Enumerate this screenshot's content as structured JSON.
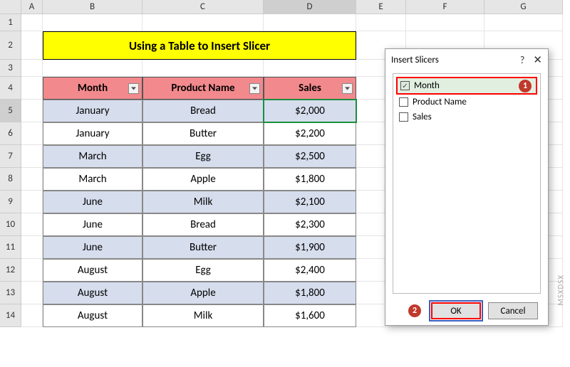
{
  "columns": [
    "A",
    "B",
    "C",
    "D",
    "E",
    "F",
    "G"
  ],
  "rows_small": [
    "1"
  ],
  "row_title": "2",
  "row_spacer": "3",
  "rows_data": [
    "4",
    "5",
    "6",
    "7",
    "8",
    "9",
    "10",
    "11",
    "12",
    "13",
    "14"
  ],
  "selected_col": "D",
  "selected_row": "5",
  "title_text": "Using a Table to Insert Slicer",
  "table": {
    "headers": [
      "Month",
      "Product Name",
      "Sales"
    ],
    "rows": [
      {
        "month": "January",
        "product": "Bread",
        "sales": "$2,000",
        "alt": true
      },
      {
        "month": "January",
        "product": "Butter",
        "sales": "$2,200",
        "alt": false
      },
      {
        "month": "March",
        "product": "Egg",
        "sales": "$2,500",
        "alt": true
      },
      {
        "month": "March",
        "product": "Apple",
        "sales": "$1,800",
        "alt": false
      },
      {
        "month": "June",
        "product": "Milk",
        "sales": "$2,100",
        "alt": true
      },
      {
        "month": "June",
        "product": "Bread",
        "sales": "$2,300",
        "alt": false
      },
      {
        "month": "June",
        "product": "Butter",
        "sales": "$1,900",
        "alt": true
      },
      {
        "month": "August",
        "product": "Egg",
        "sales": "$2,400",
        "alt": false
      },
      {
        "month": "August",
        "product": "Apple",
        "sales": "$1,800",
        "alt": true
      },
      {
        "month": "August",
        "product": "Milk",
        "sales": "$1,600",
        "alt": false
      }
    ]
  },
  "dialog": {
    "title": "Insert Slicers",
    "fields": [
      {
        "label": "Month",
        "checked": true,
        "highlight": true
      },
      {
        "label": "Product Name",
        "checked": false,
        "highlight": false
      },
      {
        "label": "Sales",
        "checked": false,
        "highlight": false
      }
    ],
    "ok_label": "OK",
    "cancel_label": "Cancel",
    "marker1": "1",
    "marker2": "2"
  },
  "watermark": "MSXDSX"
}
